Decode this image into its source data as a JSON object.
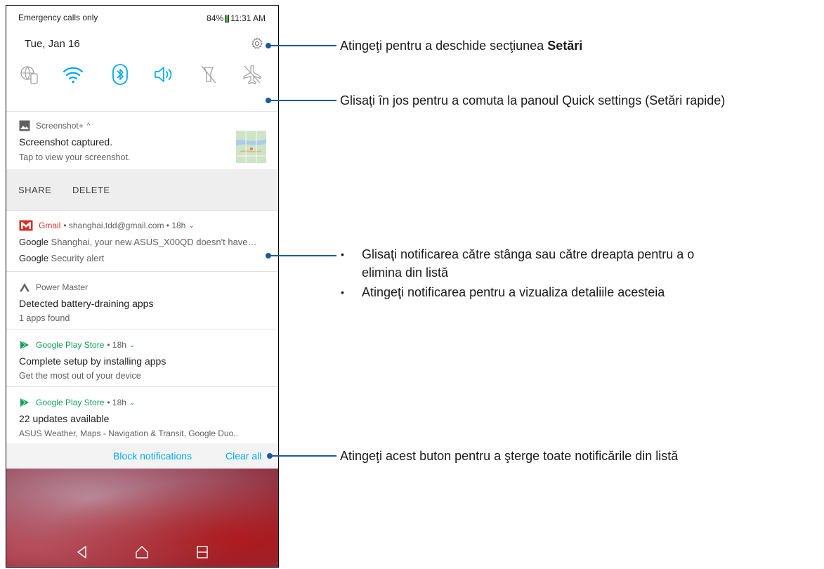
{
  "status_bar": {
    "carrier": "Emergency calls only",
    "battery": "84%",
    "time": "11:31 AM"
  },
  "quick_settings": {
    "date": "Tue, Jan 16"
  },
  "notifications": {
    "screenshot": {
      "app": "Screenshot+",
      "title": "Screenshot captured.",
      "text": "Tap to view your screenshot.",
      "actions": [
        "SHARE",
        "DELETE"
      ]
    },
    "gmail": {
      "app": "Gmail",
      "meta": "• shanghai.tdd@gmail.com • 18h",
      "line1_sender": "Google",
      "line1_text": "Shanghai, your new ASUS_X00QD doesn't have…",
      "line2_sender": "Google",
      "line2_text": "Security alert"
    },
    "power_master": {
      "app": "Power Master",
      "title": "Detected battery-draining apps",
      "text": "1 apps found"
    },
    "play_store_1": {
      "app": "Google Play Store",
      "meta": "• 18h",
      "title": "Complete setup by installing apps",
      "text": "Get the most out of your device"
    },
    "play_store_2": {
      "app": "Google Play Store",
      "meta": "• 18h",
      "title": "22 updates available",
      "text": "ASUS Weather, Maps - Navigation & Transit, Google Duo.."
    }
  },
  "footer": {
    "block": "Block notifications",
    "clear": "Clear all"
  },
  "callouts": {
    "settings_prefix": "Atingeţi pentru a deschide secţiunea ",
    "settings_bold": "Setări",
    "swipe_down": "Glisaţi în jos pentru a comuta la panoul Quick settings (Setări rapide)",
    "bullet1_line1": "Glisaţi notificarea către stânga sau către dreapta pentru a o",
    "bullet1_line2": "elimina din listă",
    "bullet2": "Atingeţi notificarea pentru a vizualiza detaliile acesteia",
    "clear_all": "Atingeţi acest buton pentru a şterge toate notificările din listă"
  },
  "colors": {
    "accent": "#03a9f4",
    "callout_line": "#1b5aa0",
    "gmail_red": "#d93025",
    "play_green": "#0f9d58"
  }
}
